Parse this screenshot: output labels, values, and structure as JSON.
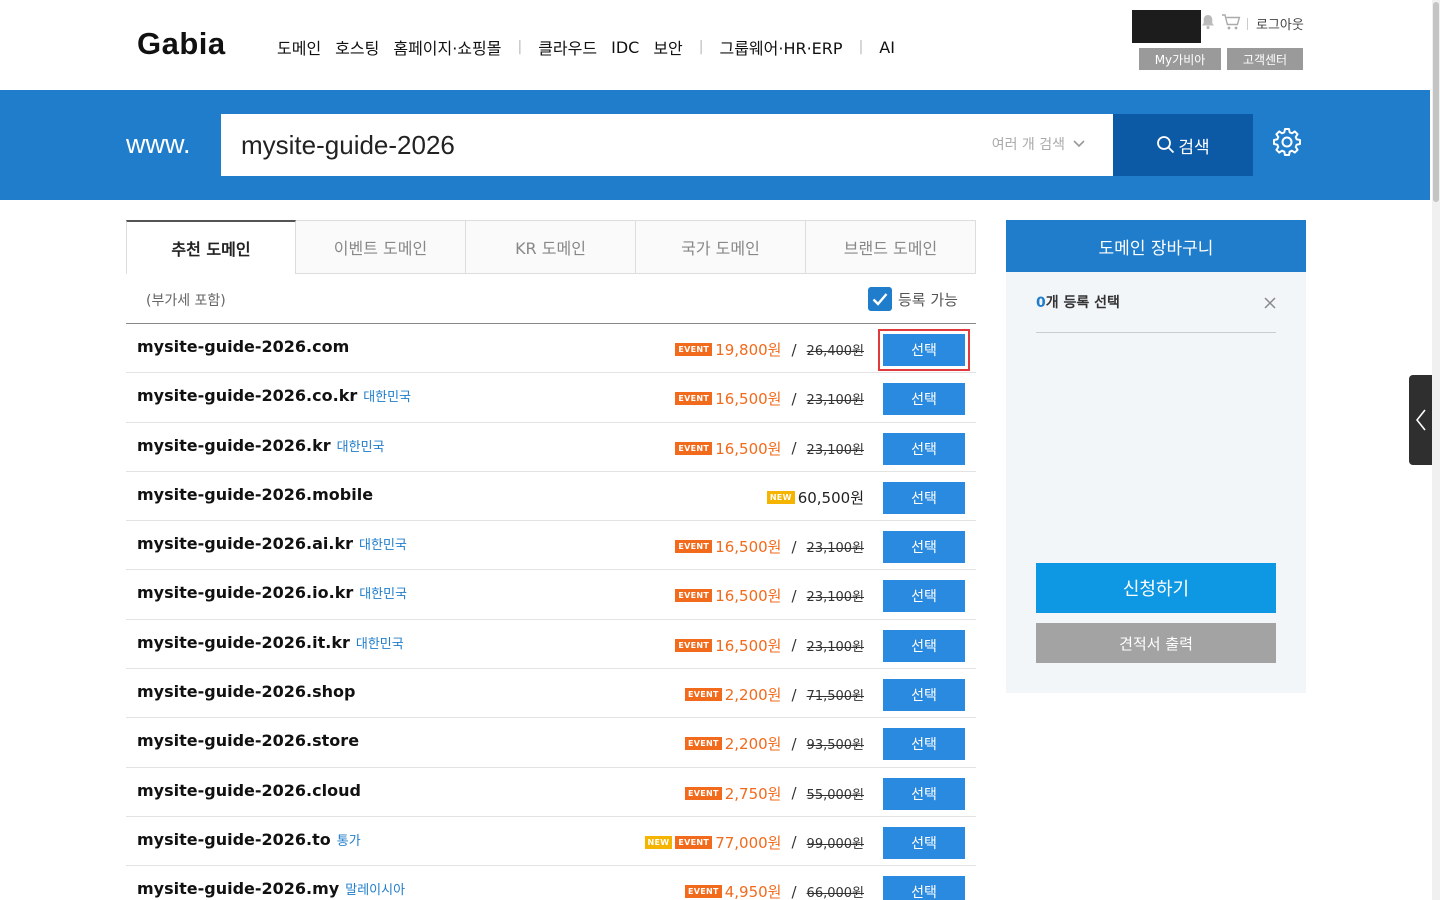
{
  "header": {
    "logo": "Gabia",
    "nav": [
      "도메인",
      "호스팅",
      "홈페이지·쇼핑몰",
      "클라우드",
      "IDC",
      "보안",
      "그룹웨어·HR·ERP",
      "AI"
    ],
    "logout": "로그아웃",
    "my_gabia": "My가비아",
    "customer_center": "고객센터"
  },
  "search": {
    "prefix": "www.",
    "value": "mysite-guide-2026",
    "multi_search": "여러 개 검색",
    "button": "검색"
  },
  "tabs": [
    "추천 도메인",
    "이벤트 도메인",
    "KR 도메인",
    "국가 도메인",
    "브랜드 도메인"
  ],
  "list": {
    "vat_note": "(부가세 포함)",
    "filter_label": "등록 가능",
    "select_label": "선택",
    "rows": [
      {
        "name": "mysite-guide-2026.com",
        "country": "",
        "badges": [
          "EVENT"
        ],
        "price": "19,800원",
        "original": "26,400원"
      },
      {
        "name": "mysite-guide-2026.co.kr",
        "country": "대한민국",
        "badges": [
          "EVENT"
        ],
        "price": "16,500원",
        "original": "23,100원"
      },
      {
        "name": "mysite-guide-2026.kr",
        "country": "대한민국",
        "badges": [
          "EVENT"
        ],
        "price": "16,500원",
        "original": "23,100원"
      },
      {
        "name": "mysite-guide-2026.mobile",
        "country": "",
        "badges": [
          "NEW"
        ],
        "price": "60,500원",
        "original": ""
      },
      {
        "name": "mysite-guide-2026.ai.kr",
        "country": "대한민국",
        "badges": [
          "EVENT"
        ],
        "price": "16,500원",
        "original": "23,100원"
      },
      {
        "name": "mysite-guide-2026.io.kr",
        "country": "대한민국",
        "badges": [
          "EVENT"
        ],
        "price": "16,500원",
        "original": "23,100원"
      },
      {
        "name": "mysite-guide-2026.it.kr",
        "country": "대한민국",
        "badges": [
          "EVENT"
        ],
        "price": "16,500원",
        "original": "23,100원"
      },
      {
        "name": "mysite-guide-2026.shop",
        "country": "",
        "badges": [
          "EVENT"
        ],
        "price": "2,200원",
        "original": "71,500원"
      },
      {
        "name": "mysite-guide-2026.store",
        "country": "",
        "badges": [
          "EVENT"
        ],
        "price": "2,200원",
        "original": "93,500원"
      },
      {
        "name": "mysite-guide-2026.cloud",
        "country": "",
        "badges": [
          "EVENT"
        ],
        "price": "2,750원",
        "original": "55,000원"
      },
      {
        "name": "mysite-guide-2026.to",
        "country": "통가",
        "badges": [
          "NEW",
          "EVENT"
        ],
        "price": "77,000원",
        "original": "99,000원"
      },
      {
        "name": "mysite-guide-2026.my",
        "country": "말레이시아",
        "badges": [
          "EVENT"
        ],
        "price": "4,950원",
        "original": "66,000원"
      }
    ]
  },
  "cart": {
    "title": "도메인 장바구니",
    "count": "0",
    "count_suffix": "개 등록 선택",
    "apply": "신청하기",
    "quote": "견적서 출력"
  },
  "colors": {
    "brand_blue": "#1f7dcb",
    "search_button": "#0c5aa6",
    "event_orange": "#f26a1b",
    "new_yellow": "#f5b400",
    "apply_blue": "#0e97e3"
  }
}
